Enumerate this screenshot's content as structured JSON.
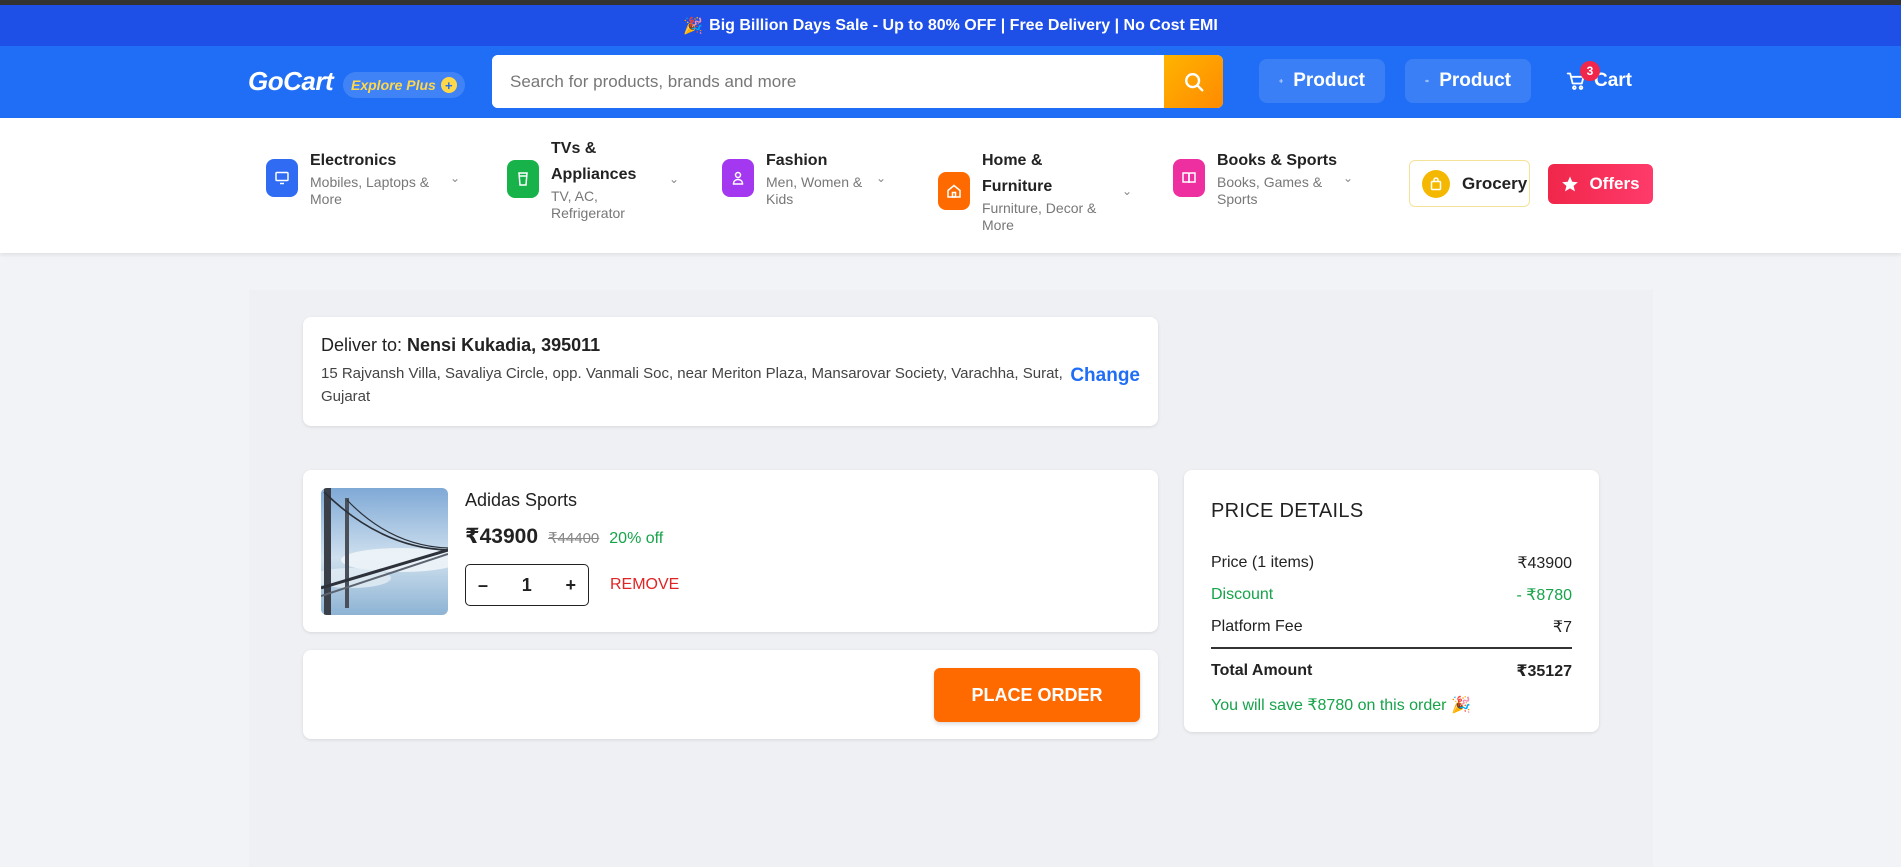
{
  "promo": {
    "emoji": "🎉",
    "text": "Big Billion Days Sale - Up to 80% OFF | Free Delivery | No Cost EMI"
  },
  "header": {
    "logo": "GoCart",
    "explore": "Explore Plus",
    "search_placeholder": "Search for products, brands and more",
    "add_product": "Product",
    "view_product": "Product",
    "cart_label": "Cart",
    "cart_count": "3"
  },
  "categories": [
    {
      "title": "Electronics",
      "sub": "Mobiles, Laptops & More",
      "color": "#2f6bf3"
    },
    {
      "title": "TVs & Appliances",
      "sub": "TV, AC, Refrigerator",
      "color": "#17b34a"
    },
    {
      "title": "Fashion",
      "sub": "Men, Women & Kids",
      "color": "#a338f0"
    },
    {
      "title": "Home & Furniture",
      "sub": "Furniture, Decor & More",
      "color": "#ff6a00"
    },
    {
      "title": "Books & Sports",
      "sub": "Books, Games & Sports",
      "color": "#ee2fa0"
    }
  ],
  "grocery": "Grocery",
  "offers": "Offers",
  "delivery": {
    "prefix": "Deliver to:",
    "name": "Nensi Kukadia, 395011",
    "address": "15 Rajvansh Villa, Savaliya Circle, opp. Vanmali Soc, near Meriton Plaza, Mansarovar Society, Varachha, Surat, Gujarat",
    "change": "Change"
  },
  "item": {
    "name": "Adidas Sports",
    "price": "₹43900",
    "mrp": "₹44400",
    "discount": "20% off",
    "qty": "1",
    "minus": "–",
    "plus": "+",
    "remove": "REMOVE"
  },
  "place_order": "PLACE ORDER",
  "price_details": {
    "title": "PRICE DETAILS",
    "price_label": "Price (1 items)",
    "price_value": "₹43900",
    "discount_label": "Discount",
    "discount_value": "- ₹8780",
    "fee_label": "Platform Fee",
    "fee_value": "₹7",
    "total_label": "Total Amount",
    "total_value": "₹35127",
    "savings": "You will save ₹8780 on this order 🎉"
  },
  "colors": {
    "brand": "#1f6ef5",
    "accent": "#ff6a00",
    "success": "#16a34a",
    "danger": "#e02424"
  }
}
